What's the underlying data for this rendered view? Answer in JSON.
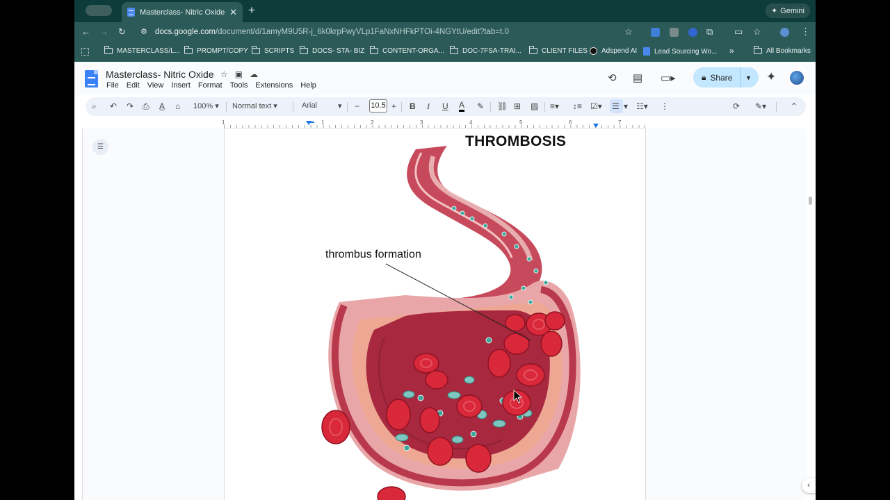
{
  "browser": {
    "tab_title": "Masterclass- Nitric Oxide - Go",
    "gemini_label": "Gemini",
    "url_host": "docs.google.com",
    "url_path": "/document/d/1amyM9U5R-j_6k0krpFwyVLp1FaNxNHFkPTOi-4NGYtU/edit?tab=t.0"
  },
  "bookmarks": [
    {
      "label": "MASTERCLASS/L...",
      "icon": "folder-icon"
    },
    {
      "label": "PROMPT/COPY",
      "icon": "folder-icon"
    },
    {
      "label": "SCRIPTS",
      "icon": "folder-icon"
    },
    {
      "label": "DOCS- STA- BIZ",
      "icon": "folder-icon"
    },
    {
      "label": "CONTENT-ORGA...",
      "icon": "folder-icon"
    },
    {
      "label": "DOC-7FSA-TRAI...",
      "icon": "folder-icon"
    },
    {
      "label": "CLIENT FILES",
      "icon": "folder-icon"
    },
    {
      "label": "Adspend AI",
      "icon": "triangle-logo-icon"
    },
    {
      "label": "Lead Sourcing Wo...",
      "icon": "docs-icon"
    }
  ],
  "bookmarks_more": "»",
  "all_bookmarks": "All Bookmarks",
  "docs": {
    "title": "Masterclass- Nitric Oxide",
    "menus": [
      "File",
      "Edit",
      "View",
      "Insert",
      "Format",
      "Tools",
      "Extensions",
      "Help"
    ],
    "share_label": "Share"
  },
  "toolbar": {
    "zoom": "100%",
    "style": "Normal text",
    "font": "Arial",
    "font_size": "10.5"
  },
  "ruler": [
    "1",
    "1",
    "2",
    "3",
    "4",
    "5",
    "6",
    "7"
  ],
  "figure": {
    "title": "THROMBOSIS",
    "label": "thrombus formation"
  },
  "colors": {
    "chrome_dark": "#0e3c3b",
    "chrome": "#2c5a58",
    "share_bg": "#c2e7ff",
    "toolbar_bg": "#edf2fa"
  }
}
